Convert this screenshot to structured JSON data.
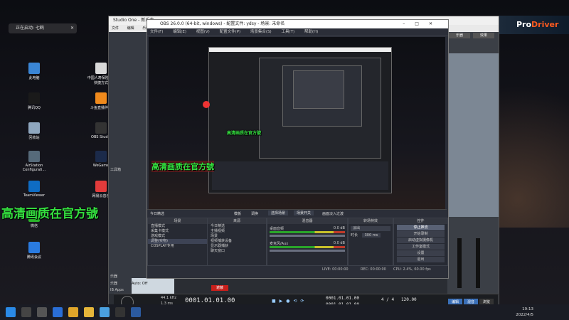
{
  "notification": {
    "text": "正在启动: 七鹤",
    "close": "✕"
  },
  "desktop_icons": [
    {
      "label": "此电脑",
      "icon": "computer-icon",
      "color": "#3a86d6"
    },
    {
      "label": "腾讯QQ",
      "icon": "qq-icon",
      "color": "#1a1a1a"
    },
    {
      "label": "回收站",
      "icon": "recycle-bin-icon",
      "color": "#8fa7bf"
    },
    {
      "label": "AirStation Configurati...",
      "icon": "airstation-icon",
      "color": "#566a7a"
    },
    {
      "label": "TeamViewer",
      "icon": "teamviewer-icon",
      "color": "#0e6cc4"
    },
    {
      "label": "微信",
      "icon": "wechat-icon",
      "color": "#2ab52a"
    },
    {
      "label": "腾讯会议",
      "icon": "tencent-meeting-icon",
      "color": "#2a7be0"
    },
    {
      "label": "中国人寿保险号 - 快捷方式",
      "icon": "shortcut-icon",
      "color": "#d9d9d9"
    },
    {
      "label": "斗鱼直播伴侣",
      "icon": "douyu-icon",
      "color": "#f08a1c"
    },
    {
      "label": "OBS Studio",
      "icon": "obs-icon",
      "color": "#333"
    },
    {
      "label": "WeGame",
      "icon": "wegame-icon",
      "color": "#1b2a4a"
    },
    {
      "label": "网易云音乐",
      "icon": "netease-music-icon",
      "color": "#e23b3b"
    }
  ],
  "watermark": "高清画质在官方號",
  "studio": {
    "title": "Studio One - 新乐曲",
    "menu": [
      "文件",
      "编辑",
      "乐曲"
    ],
    "right_tabs": [
      "乐器",
      "效果"
    ],
    "panel_labels": [
      "工具箱",
      "乐器",
      "乐器",
      "IB Apps"
    ],
    "status": "Auto: Off",
    "track_left": "24.1 kHz",
    "track_left2": "1.3 ms",
    "track_mid": "44.1 kHz",
    "transport_time": "0001.01.01.00",
    "transport_time2": "0001.01.01.00",
    "transport_time3": "0001.01.01.00",
    "tempo": "120.00",
    "sig": "4 / 4",
    "bottom_tabs": [
      "编辑",
      "混音",
      "浏览"
    ],
    "mark_label": "遮蔽"
  },
  "prodriver": {
    "brand_pre": "Pro",
    "brand_post": "Driver"
  },
  "obs": {
    "title": "OBS 26.0.0 (64-bit, windows) - 配置文件: ydsy - 场景: 未命名",
    "menu": [
      "文件(F)",
      "编辑(E)",
      "视图(V)",
      "配置文件(P)",
      "场景集合(S)",
      "工具(T)",
      "帮助(H)"
    ],
    "transitions_bar": [
      "模板",
      "调换",
      "选择场景",
      "场景开关",
      "画面淡入过渡"
    ],
    "scenes_title": "场景",
    "scenes": [
      "直播模式",
      "采集卡模式",
      "游戏模式",
      "调整(实物)",
      "COSPLAY专用"
    ],
    "sources_title": "来源",
    "sources": [
      "今日精选",
      "主播视频",
      "场景",
      "视频捕获设备",
      "显示器捕获",
      "聊天窗口"
    ],
    "mixer_title": "混音器",
    "mixer": [
      {
        "name": "桌面音频",
        "db": "0.0 dB"
      },
      {
        "name": "麦克风/Aux",
        "db": "0.0 dB"
      }
    ],
    "transition_title": "转场特效",
    "transition_type": "淡出",
    "transition_duration_label": "时长",
    "transition_duration": "300 ms",
    "controls_title": "控件",
    "controls": [
      "停止推流",
      "开始录制",
      "启动虚拟摄像机",
      "工作室模式",
      "设置",
      "退出"
    ],
    "status": {
      "live": "LIVE: 00:00:00",
      "rec": "REC: 00:00:00",
      "cpu": "CPU: 2.4%, 60.00 fps"
    },
    "scene_header_label": "今日精选"
  },
  "taskbar": {
    "time": "19:13",
    "date": "2022/4/5",
    "icons": [
      "start-icon",
      "search-icon",
      "task-view-icon",
      "edge-icon",
      "chrome-icon",
      "explorer-icon",
      "store-icon",
      "obs-taskbar-icon",
      "studio-one-taskbar-icon"
    ]
  }
}
